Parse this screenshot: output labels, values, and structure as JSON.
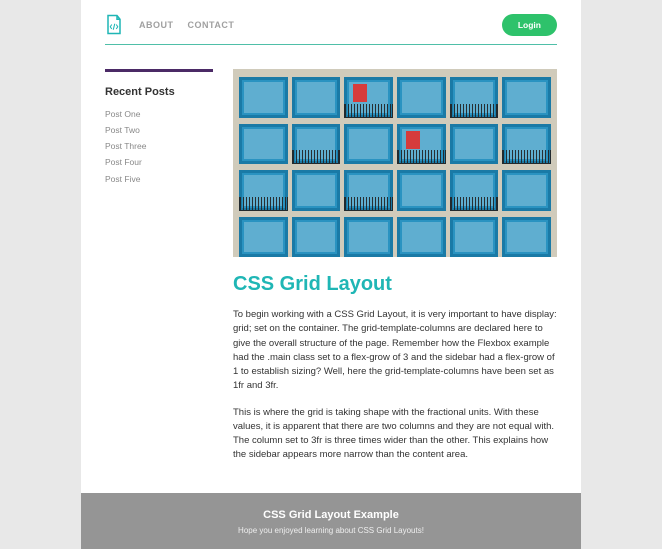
{
  "header": {
    "nav": {
      "about": "ABOUT",
      "contact": "CONTACT"
    },
    "login_label": "Login"
  },
  "sidebar": {
    "title": "Recent Posts",
    "items": [
      {
        "label": "Post One"
      },
      {
        "label": "Post Two"
      },
      {
        "label": "Post Three"
      },
      {
        "label": "Post Four"
      },
      {
        "label": "Post Five"
      }
    ]
  },
  "article": {
    "title": "CSS Grid Layout",
    "p1": "To begin working with a CSS Grid Layout, it is very important to have display: grid; set on the container. The grid-template-columns are declared here to give the overall structure of the page. Remember how the Flexbox example had the .main class set to a flex-grow of 3 and the sidebar had a flex-grow of 1 to establish sizing? Well, here the grid-template-columns have been set as 1fr and 3fr.",
    "p2": "This is where the grid is taking shape with the fractional units. With these values, it is apparent that there are two columns and they are not equal with. The column set to 3fr is three times wider than the other. This explains how the sidebar appears more narrow than the content area."
  },
  "footer": {
    "title": "CSS Grid Layout Example",
    "subtitle": "Hope you enjoyed learning about CSS Grid Layouts!"
  }
}
